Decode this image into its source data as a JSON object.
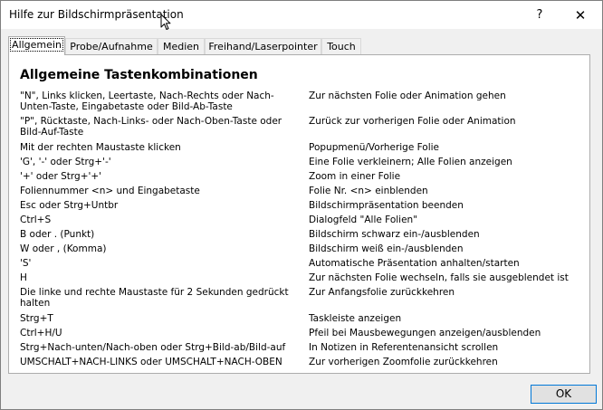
{
  "window": {
    "title": "Hilfe zur Bildschirmpräsentation",
    "help_glyph": "?",
    "close_glyph": "✕"
  },
  "tabs": [
    {
      "label": "Allgemein",
      "active": true
    },
    {
      "label": "Probe/Aufnahme",
      "active": false
    },
    {
      "label": "Medien",
      "active": false
    },
    {
      "label": "Freihand/Laserpointer",
      "active": false
    },
    {
      "label": "Touch",
      "active": false
    }
  ],
  "panel": {
    "heading": "Allgemeine Tastenkombinationen",
    "rows": [
      {
        "keys": "\"N\", Links klicken, Leertaste, Nach-Rechts oder Nach-Unten-Taste, Eingabetaste oder Bild-Ab-Taste",
        "action": "Zur nächsten Folie oder Animation gehen"
      },
      {
        "keys": "\"P\", Rücktaste, Nach-Links- oder Nach-Oben-Taste oder Bild-Auf-Taste",
        "action": "Zurück zur vorherigen Folie oder Animation"
      },
      {
        "keys": "Mit der rechten Maustaste klicken",
        "action": "Popupmenü/Vorherige Folie"
      },
      {
        "keys": "'G', '-' oder Strg+'-'",
        "action": "Eine Folie verkleinern; Alle Folien anzeigen"
      },
      {
        "keys": "'+' oder Strg+'+'",
        "action": "Zoom in einer Folie"
      },
      {
        "keys": "Foliennummer <n> und Eingabetaste",
        "action": "Folie Nr. <n> einblenden"
      },
      {
        "keys": "Esc oder Strg+Untbr",
        "action": "Bildschirmpräsentation beenden"
      },
      {
        "keys": "Ctrl+S",
        "action": "Dialogfeld \"Alle Folien\""
      },
      {
        "keys": "B oder . (Punkt)",
        "action": "Bildschirm schwarz ein-/ausblenden"
      },
      {
        "keys": "W oder , (Komma)",
        "action": "Bildschirm weiß ein-/ausblenden"
      },
      {
        "keys": "'S'",
        "action": "Automatische Präsentation anhalten/starten"
      },
      {
        "keys": "H",
        "action": "Zur nächsten Folie wechseln, falls sie ausgeblendet ist"
      },
      {
        "keys": "Die linke und rechte Maustaste für 2 Sekunden gedrückt halten",
        "action": "Zur Anfangsfolie zurückkehren"
      },
      {
        "keys": "Strg+T",
        "action": "Taskleiste anzeigen"
      },
      {
        "keys": "Ctrl+H/U",
        "action": "Pfeil bei Mausbewegungen anzeigen/ausblenden"
      },
      {
        "keys": "Strg+Nach-unten/Nach-oben oder Strg+Bild-ab/Bild-auf",
        "action": "In Notizen in Referentenansicht scrollen"
      },
      {
        "keys": "UMSCHALT+NACH-LINKS oder UMSCHALT+NACH-OBEN",
        "action": "Zur vorherigen Zoomfolie zurückkehren"
      }
    ]
  },
  "footer": {
    "ok_label": "OK"
  }
}
